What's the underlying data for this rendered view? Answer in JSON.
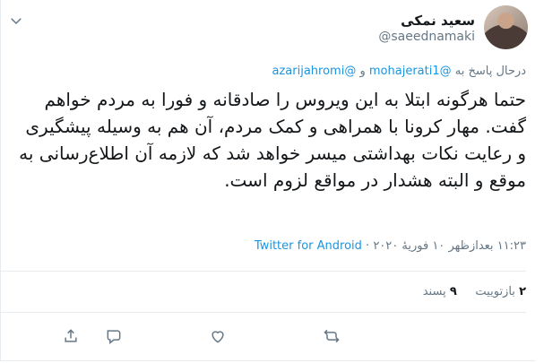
{
  "tweet": {
    "display_name": "سعید نمکی",
    "handle": "@saeednamaki",
    "reply_prefix": "درحال پاسخ به",
    "reply_mentions": [
      "@mohajerati1",
      "@azarijahromi"
    ],
    "reply_joiner": "و",
    "text": "حتما هرگونه ابتلا به این ویروس را صادقانه و فورا به مردم خواهم گفت. مهار کرونا با همراهی و کمک مردم، آن هم به وسیله پیشگیری و رعایت نکات بهداشتی میسر خواهد شد که لازمه آن اطلاع‌رسانی به موقع و البته هشدار در مواقع لزوم است.",
    "time": "۱۱:۲۳ بعدازظهر",
    "separator": "·",
    "date": "۱۰ فوریهٔ ۲۰۲۰",
    "source": "Twitter for Android",
    "retweets_count": "۲",
    "retweets_label": "بازتوییت",
    "likes_count": "۹",
    "likes_label": "پسند"
  },
  "colors": {
    "text": "#14171a",
    "secondary": "#657786",
    "link": "#1b95e0",
    "divider": "#e6ecf0"
  },
  "icons": {
    "menu": "chevron-down-icon",
    "reply": "reply-icon",
    "retweet": "retweet-icon",
    "like": "heart-icon",
    "share": "share-icon"
  }
}
